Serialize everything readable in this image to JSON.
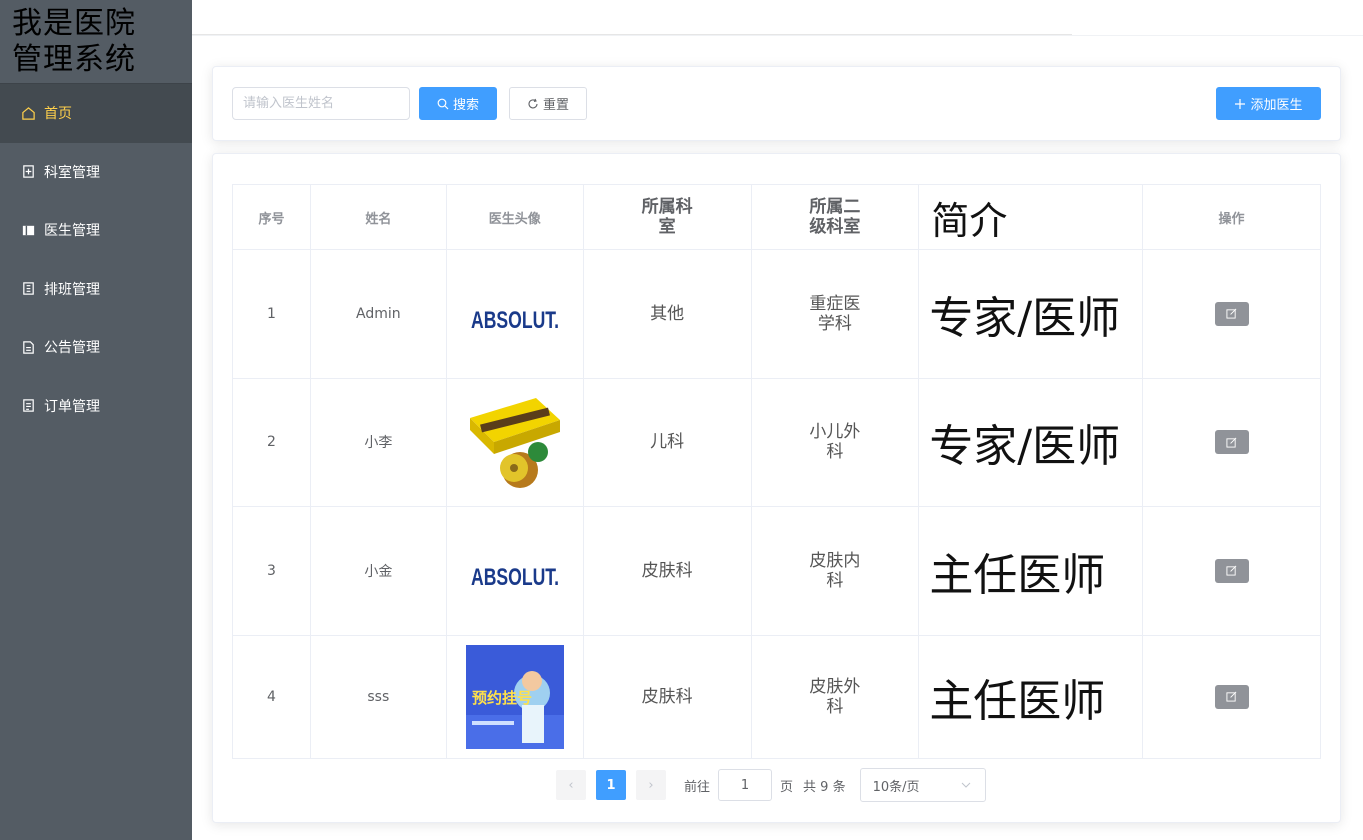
{
  "app": {
    "title": "我是医院管理系统",
    "title_line1": "我是医院",
    "title_line2": "管理系统"
  },
  "sidebar": {
    "items": [
      {
        "label": "首页",
        "icon": "home-icon",
        "active": true
      },
      {
        "label": "科室管理",
        "icon": "document-add-icon"
      },
      {
        "label": "医生管理",
        "icon": "notebook-icon"
      },
      {
        "label": "排班管理",
        "icon": "tickets-icon"
      },
      {
        "label": "公告管理",
        "icon": "document-icon"
      },
      {
        "label": "订单管理",
        "icon": "list-document-icon"
      }
    ]
  },
  "search": {
    "placeholder": "请输入医生姓名",
    "value": "",
    "search_label": "搜索",
    "reset_label": "重置",
    "add_label": "添加医生"
  },
  "table": {
    "headers": [
      "序号",
      "姓名",
      "医生头像",
      "所属科室",
      "所属二级科室",
      "简介",
      "操作"
    ],
    "header_lines": {
      "dept": [
        "所属科",
        "室"
      ],
      "subdept": [
        "所属二",
        "级科室"
      ]
    },
    "rows": [
      {
        "index": "1",
        "name": "Admin",
        "avatar": "absolut-logo",
        "dept": "其他",
        "subdept_l1": "重症医",
        "subdept_l2": "学科",
        "intro": "专家/医师"
      },
      {
        "index": "2",
        "name": "小李",
        "avatar": "kiwi-box",
        "dept": "儿科",
        "subdept_l1": "小儿外",
        "subdept_l2": "科",
        "intro": "专家/医师"
      },
      {
        "index": "3",
        "name": "小金",
        "avatar": "absolut-logo",
        "dept": "皮肤科",
        "subdept_l1": "皮肤内",
        "subdept_l2": "科",
        "intro": "主任医师"
      },
      {
        "index": "4",
        "name": "sss",
        "avatar": "appointment-poster",
        "dept": "皮肤科",
        "subdept_l1": "皮肤外",
        "subdept_l2": "科",
        "intro": "主任医师"
      }
    ],
    "logo_text": "ABSOLUT.",
    "poster_text": "预约挂号"
  },
  "pagination": {
    "current_page": "1",
    "goto_label": "前往",
    "goto_value": "1",
    "page_unit": "页",
    "total_label": "共 9 条",
    "page_size": "10条/页"
  },
  "colors": {
    "sidebar": "#545c64",
    "active_text": "#ffd04b",
    "primary": "#409eff",
    "edit_button": "#909399"
  }
}
